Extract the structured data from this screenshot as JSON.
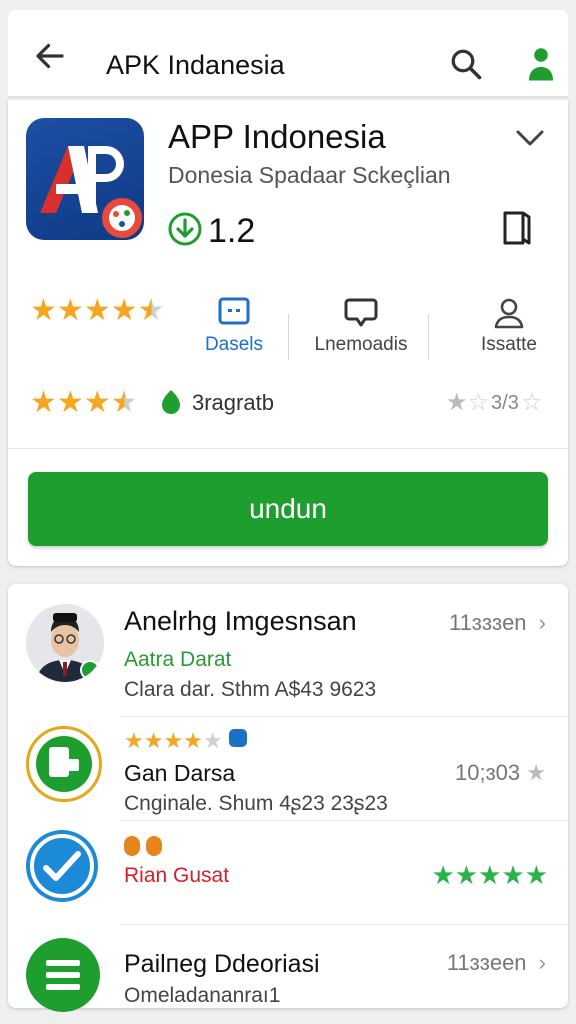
{
  "topbar": {
    "title": "APK Indanesia",
    "back_icon": "arrow-left-icon",
    "search_icon": "search-icon",
    "profile_icon": "person-icon"
  },
  "app": {
    "name": "APP Indonesia",
    "subtitle": "Donesia Spadaar Sckeçlian",
    "version": "1.2",
    "icon_letters": "AP",
    "rating_stars": 4.5,
    "stats": [
      {
        "label": "Dasels",
        "icon": "chat-square-icon"
      },
      {
        "label": "Lnemoadis",
        "icon": "speech-bubble-icon"
      },
      {
        "label": "Issatte",
        "icon": "user-outline-icon"
      }
    ],
    "second_rating_stars": 3.5,
    "download_label": "3ragratb",
    "right_rating_stars": 1,
    "right_rating_text": "3/3",
    "install_label": "undun"
  },
  "list": [
    {
      "title": "Anelrhg Imgesnsan",
      "sub": "Aatra Darat",
      "sub_color": "#2a9a35",
      "detail": "Clara dar. Sthm A$43 9623",
      "right": "11ɜɜɜen",
      "avatar": "person-photo"
    },
    {
      "title": "Gan Darsa",
      "sub": "",
      "detail": "Cnginale. Shum 4ʂ23 23ʂ23",
      "right": "10;ɜ03",
      "avatar": "green-app-icon",
      "stars": 4.5
    },
    {
      "title": "",
      "sub": "Rian Gusat",
      "sub_color": "#d4202a",
      "detail": "",
      "right": "",
      "avatar": "check-icon",
      "stars_green": 5
    },
    {
      "title": "Pailпeg Ddeoriasi",
      "sub": "",
      "detail": "Omeladananraı1",
      "right": "11ɜɜeen",
      "avatar": "list-icon"
    }
  ],
  "colors": {
    "accent_green": "#1e9e2e",
    "star_orange": "#f5a623",
    "blue": "#1d4fa3"
  }
}
